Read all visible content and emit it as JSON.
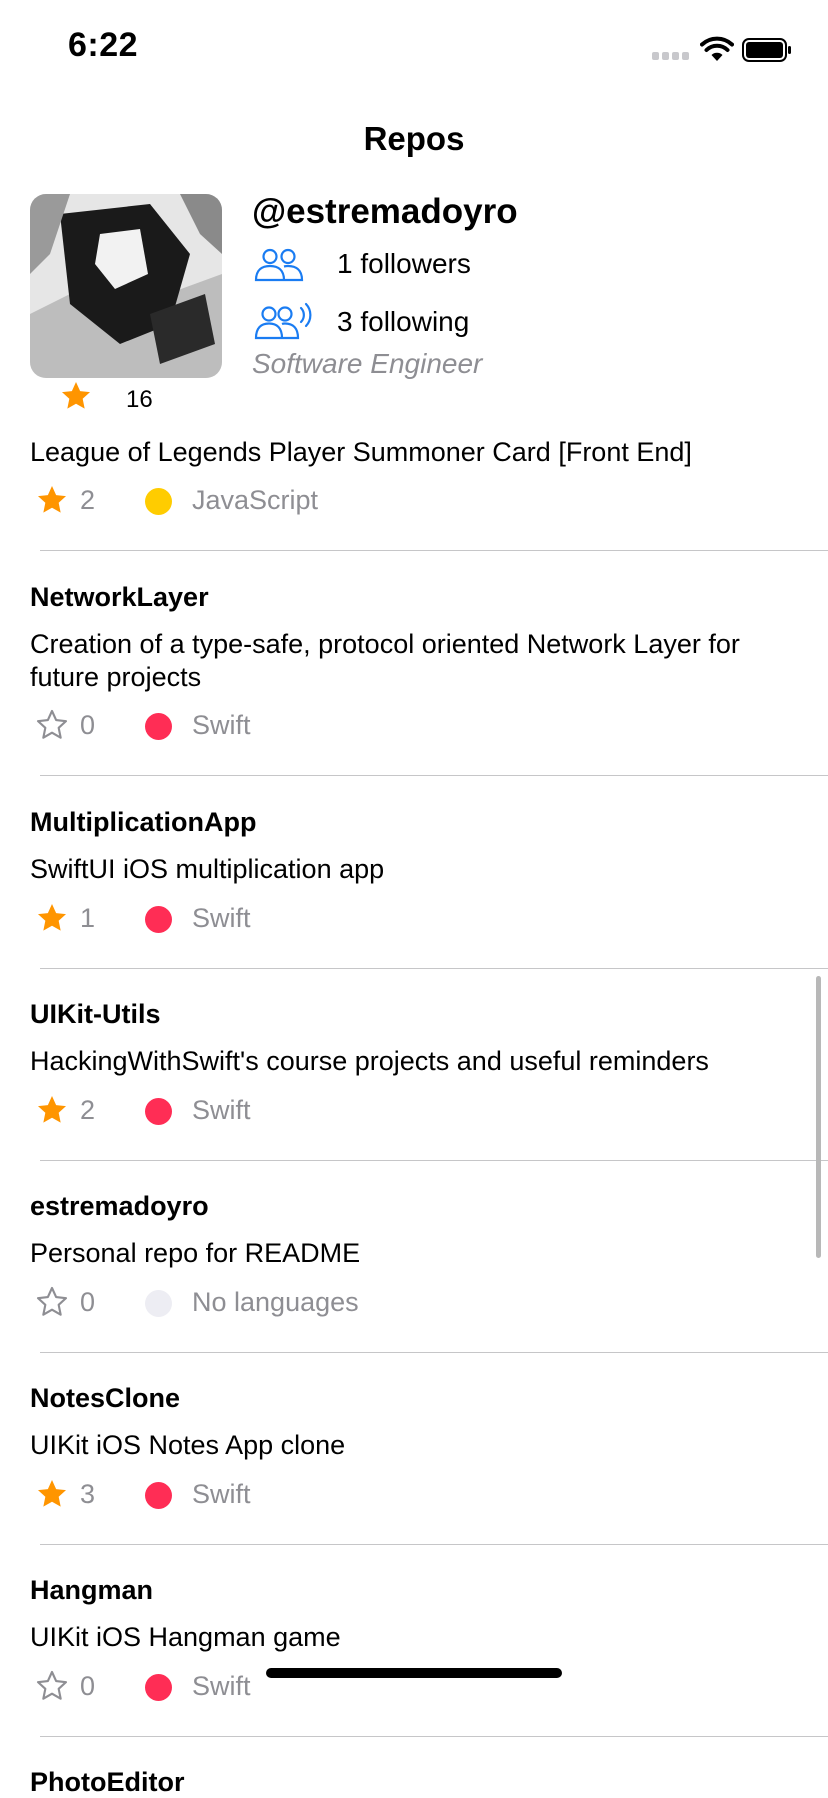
{
  "status_bar": {
    "time": "6:22"
  },
  "nav": {
    "title": "Repos"
  },
  "profile": {
    "username": "@estremadoyro",
    "followers": "1 followers",
    "following": "3 following",
    "bio": "Software Engineer",
    "stars": "16"
  },
  "colors": {
    "accent": "#1a7cf2",
    "star": "#ff9500",
    "javascript": "#ffcc00",
    "swift": "#ff2d55",
    "none": "#ededf3"
  },
  "repos": [
    {
      "name": "",
      "description": "League of Legends Player Summoner Card [Front End]",
      "stars": "2",
      "starred": true,
      "language": "JavaScript"
    },
    {
      "name": "NetworkLayer",
      "description": "Creation of a type-safe, protocol oriented Network Layer for future projects",
      "stars": "0",
      "starred": false,
      "language": "Swift"
    },
    {
      "name": "MultiplicationApp",
      "description": "SwiftUI iOS multiplication app",
      "stars": "1",
      "starred": true,
      "language": "Swift"
    },
    {
      "name": "UIKit-Utils",
      "description": "HackingWithSwift's course projects and useful reminders",
      "stars": "2",
      "starred": true,
      "language": "Swift"
    },
    {
      "name": "estremadoyro",
      "description": "Personal repo for README",
      "stars": "0",
      "starred": false,
      "language": "No languages"
    },
    {
      "name": "NotesClone",
      "description": "UIKit iOS Notes App clone",
      "stars": "3",
      "starred": true,
      "language": "Swift"
    },
    {
      "name": "Hangman",
      "description": "UIKit iOS Hangman game",
      "stars": "0",
      "starred": false,
      "language": "Swift"
    },
    {
      "name": "PhotoEditor",
      "description": "",
      "stars": "",
      "starred": false,
      "language": ""
    }
  ]
}
